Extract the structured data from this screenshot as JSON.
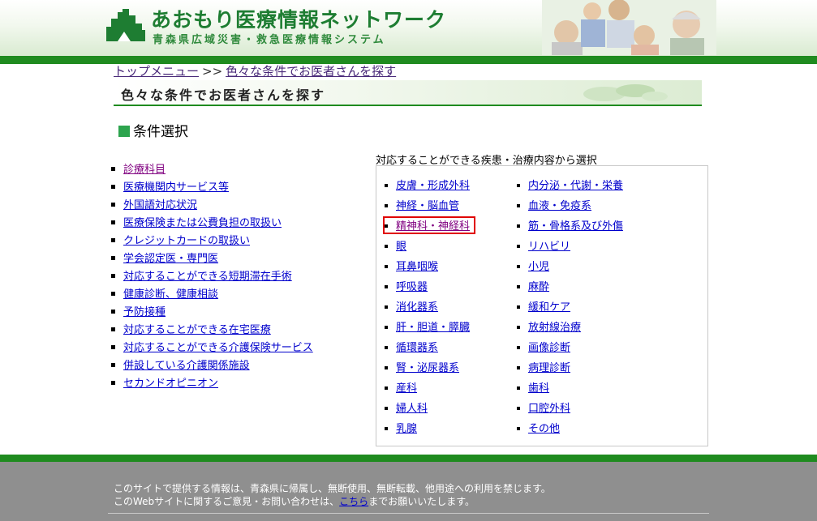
{
  "header": {
    "title": "あおもり医療情報ネットワーク",
    "subtitle": "青森県広域災害・救急医療情報システム"
  },
  "breadcrumb": {
    "home": "トップメニュー",
    "separator": ">>",
    "current": "色々な条件でお医者さんを探す"
  },
  "page_title": "色々な条件でお医者さんを探す",
  "section_heading": "条件選択",
  "left_items": [
    "診療科目",
    "医療機関内サービス等",
    "外国語対応状況",
    "医療保険または公費負担の取扱い",
    "クレジットカードの取扱い",
    "学会認定医・専門医",
    "対応することができる短期滞在手術",
    "健康診断、健康相談",
    "予防接種",
    "対応することができる在宅医療",
    "対応することができる介護保険サービス",
    "併設している介護関係施設",
    "セカンドオピニオン"
  ],
  "right_panel": {
    "caption": "対応することができる疾患・治療内容から選択",
    "column_a": [
      "皮膚・形成外科",
      "神経・脳血管",
      "精神科・神経科",
      "眼",
      "耳鼻咽喉",
      "呼吸器",
      "消化器系",
      "肝・胆道・膵臓",
      "循環器系",
      "腎・泌尿器系",
      "産科",
      "婦人科",
      "乳腺"
    ],
    "column_b": [
      "内分泌・代謝・栄養",
      "血液・免疫系",
      "筋・骨格系及び外傷",
      "リハビリ",
      "小児",
      "麻酔",
      "緩和ケア",
      "放射線治療",
      "画像診断",
      "病理診断",
      "歯科",
      "口腔外科",
      "その他"
    ],
    "selected": "精神科・神経科"
  },
  "footer": {
    "line1": "このサイトで提供する情報は、青森県に帰属し、無断使用、無断転載、他用途への利用を禁じます。",
    "line2_prefix": "このWebサイトに関するご意見・お問い合わせは、",
    "line2_link": "こちら",
    "line2_suffix": "までお願いいたします。"
  },
  "colors": {
    "brand_green": "#1f8b1f",
    "link": "#0000cc",
    "visited_link": "#800080",
    "highlight": "#e00000",
    "footer_bg": "#8f8f8f"
  }
}
